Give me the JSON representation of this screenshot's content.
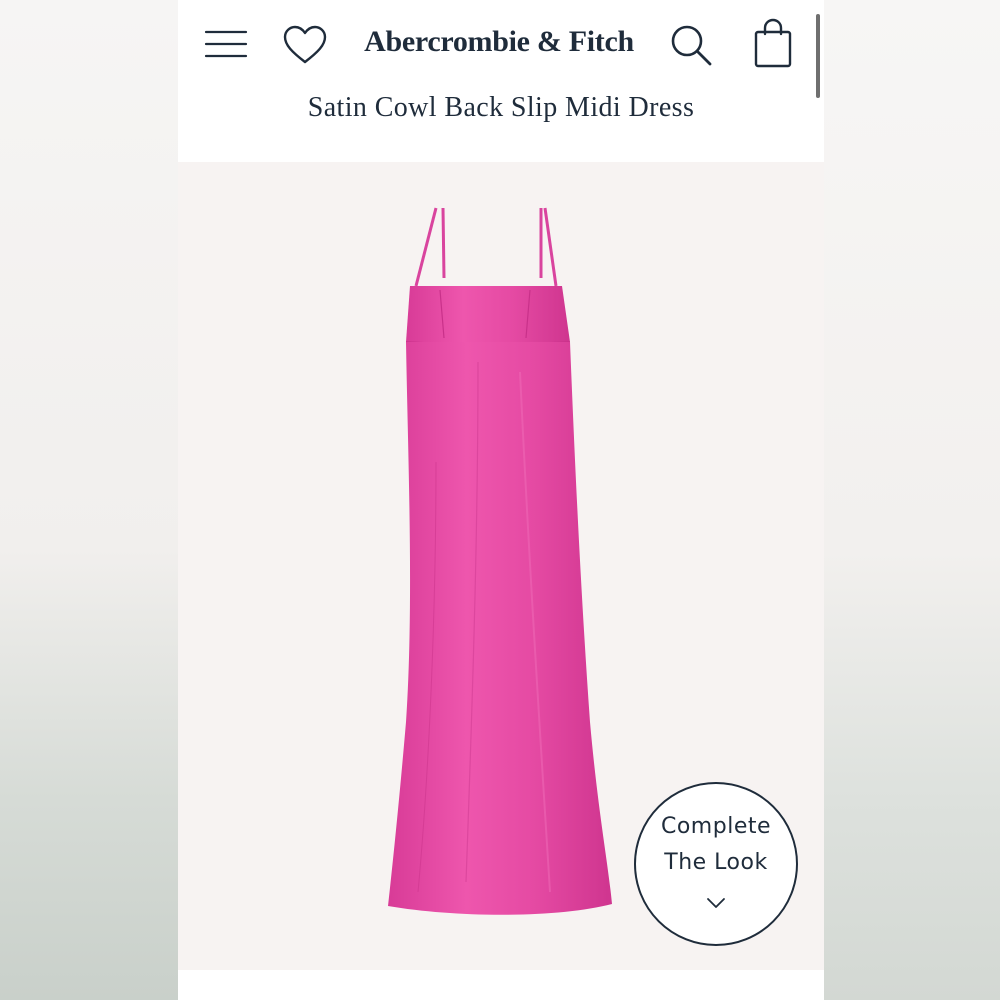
{
  "header": {
    "brand": "Abercrombie & Fitch",
    "icons": {
      "menu": "menu-icon",
      "favorite": "heart-icon",
      "search": "search-icon",
      "bag": "shopping-bag-icon"
    }
  },
  "product": {
    "title": "Satin Cowl Back Slip Midi Dress",
    "color": "#e54aa3"
  },
  "complete_the_look": {
    "line1": "Complete",
    "line2": "The Look",
    "icon": "chevron-down-icon"
  },
  "colors": {
    "text_primary": "#1f2c3b",
    "image_background": "#f7f3f2"
  }
}
